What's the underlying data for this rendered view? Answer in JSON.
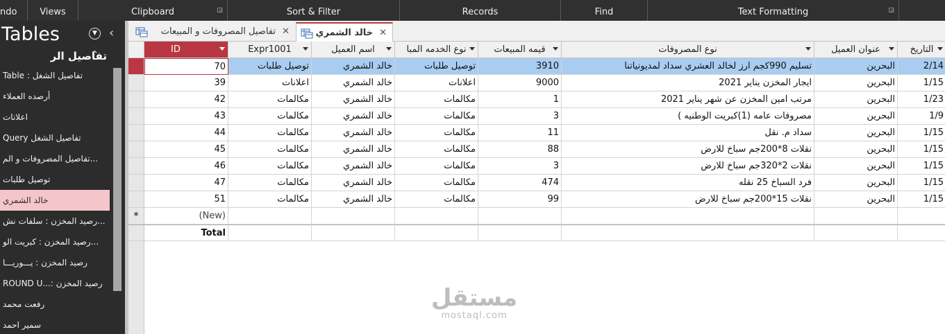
{
  "ribbon": {
    "groups": [
      "ndo",
      "Views",
      "Clipboard",
      "Sort & Filter",
      "Records",
      "Find",
      "Text Formatting"
    ]
  },
  "nav": {
    "title": "Tables",
    "group_label": "تفاصيل الر",
    "items": [
      "Table : تفاصيل الشغل",
      "أرصده العملاء",
      "اعلانات",
      "Query تفاصيل الشغل",
      "تفاصيل المصروفات و الم...",
      "توصيل طلبات",
      "خالد الشمري",
      "رصيد المخزن : سلفات نش...",
      "رصيد المخزن : كبريت الو...",
      "رصيد المخزن : يـــوريـــا",
      "ROUND U...: رصيد المخزن",
      "رفعت محمد",
      "سمير احمد"
    ],
    "active_index": 6
  },
  "tabs": [
    {
      "label": "تفاصيل المصروفات و المبيعات"
    },
    {
      "label": "خالد الشمري"
    }
  ],
  "grid": {
    "columns": [
      "ID",
      "Expr1001",
      "اسم العميل",
      "نوع الخدمه المبا",
      "قيمه المبيعات",
      "نوع المصروفات",
      "عنوان العميل",
      "التاريخ"
    ],
    "rows": [
      {
        "id": "70",
        "expr": "توصيل طلبات",
        "customer": "خالد الشمري",
        "service": "توصيل طلبات",
        "sales": "3910",
        "expense": "تسليم 990كجم ارز لخالد العشري سداد لمديونياتنا",
        "address": "البحرين",
        "date": "2/14"
      },
      {
        "id": "39",
        "expr": "اعلانات",
        "customer": "خالد الشمري",
        "service": "اعلانات",
        "sales": "9000",
        "expense": "ايجار المخزن يناير 2021",
        "address": "البحرين",
        "date": "1/15"
      },
      {
        "id": "42",
        "expr": "مكالمات",
        "customer": "خالد الشمري",
        "service": "مكالمات",
        "sales": "1",
        "expense": "مرتب امين المخزن عن شهر يناير 2021",
        "address": "البحرين",
        "date": "1/23"
      },
      {
        "id": "43",
        "expr": "مكالمات",
        "customer": "خالد الشمري",
        "service": "مكالمات",
        "sales": "3",
        "expense": "مصروفات عامه (1)كبريت الوطنيه )",
        "address": "البحرين",
        "date": "1/9"
      },
      {
        "id": "44",
        "expr": "مكالمات",
        "customer": "خالد الشمري",
        "service": "مكالمات",
        "sales": "11",
        "expense": "سداد م. نقل",
        "address": "البحرين",
        "date": "1/15"
      },
      {
        "id": "45",
        "expr": "مكالمات",
        "customer": "خالد الشمري",
        "service": "مكالمات",
        "sales": "88",
        "expense": "نقلات 8*200جم سباخ للارض",
        "address": "البحرين",
        "date": "1/15"
      },
      {
        "id": "46",
        "expr": "مكالمات",
        "customer": "خالد الشمري",
        "service": "مكالمات",
        "sales": "3",
        "expense": "نقلات 2*320جم سباخ للارض",
        "address": "البحرين",
        "date": "1/15"
      },
      {
        "id": "47",
        "expr": "مكالمات",
        "customer": "خالد الشمري",
        "service": "مكالمات",
        "sales": "474",
        "expense": "فرد السباخ 25 نقله",
        "address": "البحرين",
        "date": "1/15"
      },
      {
        "id": "51",
        "expr": "مكالمات",
        "customer": "خالد الشمري",
        "service": "مكالمات",
        "sales": "99",
        "expense": "نقلات 15*200جم سباخ للارض",
        "address": "البحرين",
        "date": "1/15"
      }
    ],
    "new_label": "(New)",
    "total_label": "Total",
    "new_marker": "*"
  },
  "watermark": {
    "arabic": "مستقل",
    "latin": "mostaql.com"
  },
  "colors": {
    "accent": "#b93743",
    "selected_row": "#a9cdf0",
    "active_nav": "#f4c6cc",
    "nav_bg": "#2c2c2c",
    "ribbon_bg": "#303030"
  }
}
